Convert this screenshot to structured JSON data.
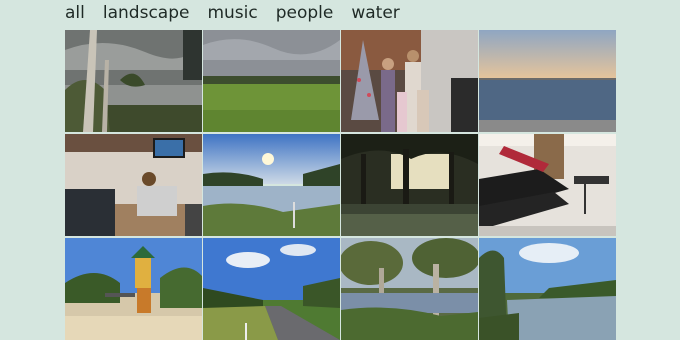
{
  "nav": {
    "tabs": [
      "all",
      "landscape",
      "music",
      "people",
      "water"
    ]
  },
  "gallery": {
    "photos": [
      "palm-trees-stormy-sky",
      "green-field-cloudy-sky",
      "family-christmas-tree",
      "lake-sunset-jetty",
      "child-at-desk-living-room",
      "river-sunset-reflection",
      "flooded-trees-sunset",
      "keyboards-music-room",
      "playground-blue-sky",
      "country-road-clouds",
      "trees-in-water",
      "river-blue-sky"
    ]
  }
}
